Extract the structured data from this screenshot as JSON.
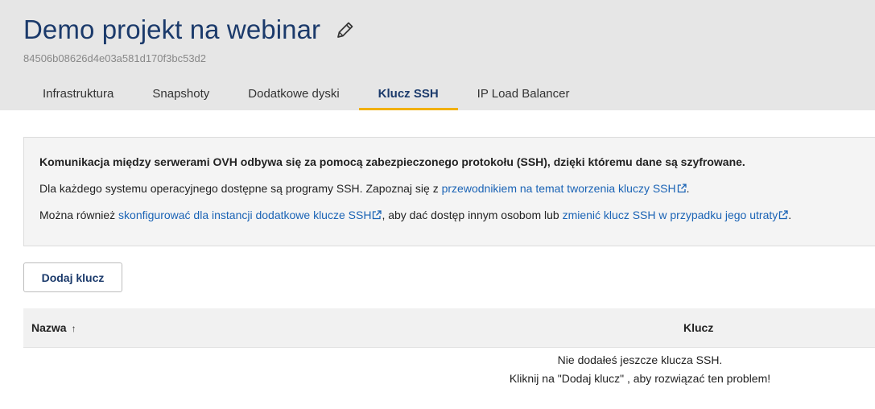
{
  "header": {
    "title": "Demo projekt na webinar",
    "project_id": "84506b08626d4e03a581d170f3bc53d2",
    "edit_icon": "pencil-icon"
  },
  "tabs": [
    {
      "label": "Infrastruktura",
      "active": false
    },
    {
      "label": "Snapshoty",
      "active": false
    },
    {
      "label": "Dodatkowe dyski",
      "active": false
    },
    {
      "label": "Klucz SSH",
      "active": true
    },
    {
      "label": "IP Load Balancer",
      "active": false
    }
  ],
  "info": {
    "line1": "Komunikacja między serwerami OVH odbywa się za pomocą zabezpieczonego protokołu (SSH), dzięki któremu dane są szyfrowane.",
    "line2_prefix": "Dla każdego systemu operacyjnego dostępne są programy SSH. Zapoznaj się z ",
    "line2_link": "przewodnikiem na temat tworzenia kluczy SSH",
    "line2_suffix": ".",
    "line3_prefix": "Można również ",
    "line3_link1": "skonfigurować dla instancji dodatkowe klucze SSH",
    "line3_middle": ", aby dać dostęp innym osobom lub ",
    "line3_link2": "zmienić klucz SSH w przypadku jego utraty",
    "line3_suffix": "."
  },
  "actions": {
    "add_key_label": "Dodaj klucz"
  },
  "table": {
    "columns": [
      {
        "label": "Nazwa",
        "sort": "ascending",
        "sort_glyph": "↑"
      },
      {
        "label": "Klucz"
      }
    ],
    "empty_line1": "Nie dodałeś jeszcze klucza SSH.",
    "empty_line2": "Kliknij na \"Dodaj klucz\" , aby rozwiązać ten problem!"
  },
  "colors": {
    "header_bg": "#e6e6e6",
    "title": "#1b3a6b",
    "link": "#1a63b5",
    "active_tab_underline": "#f1b00c"
  }
}
